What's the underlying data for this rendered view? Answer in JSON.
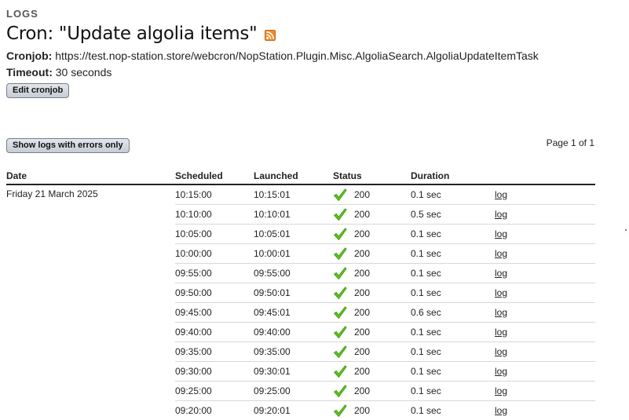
{
  "header": {
    "section_label": "LOGS",
    "title": "Cron: \"Update algolia items\"",
    "rss_icon": "rss-feed-icon"
  },
  "meta": {
    "cronjob_label": "Cronjob:",
    "cronjob_url": "https://test.nop-station.store/webcron/NopStation.Plugin.Misc.AlgoliaSearch.AlgoliaUpdateItemTask",
    "timeout_label": "Timeout:",
    "timeout_value": "30 seconds"
  },
  "actions": {
    "edit_label": "Edit cronjob",
    "errors_filter_label": "Show logs with errors only"
  },
  "pager": {
    "text": "Page 1 of 1"
  },
  "table": {
    "columns": [
      "Date",
      "Scheduled",
      "Launched",
      "Status",
      "Duration",
      ""
    ],
    "date": "Friday 21 March 2025",
    "status_icon": "green-check-icon",
    "rows": [
      {
        "scheduled": "10:15:00",
        "launched": "10:15:01",
        "status": "200",
        "duration": "0.1 sec",
        "log": "log"
      },
      {
        "scheduled": "10:10:00",
        "launched": "10:10:01",
        "status": "200",
        "duration": "0.5 sec",
        "log": "log"
      },
      {
        "scheduled": "10:05:00",
        "launched": "10:05:01",
        "status": "200",
        "duration": "0.1 sec",
        "log": "log"
      },
      {
        "scheduled": "10:00:00",
        "launched": "10:00:01",
        "status": "200",
        "duration": "0.1 sec",
        "log": "log"
      },
      {
        "scheduled": "09:55:00",
        "launched": "09:55:00",
        "status": "200",
        "duration": "0.1 sec",
        "log": "log"
      },
      {
        "scheduled": "09:50:00",
        "launched": "09:50:01",
        "status": "200",
        "duration": "0.1 sec",
        "log": "log"
      },
      {
        "scheduled": "09:45:00",
        "launched": "09:45:01",
        "status": "200",
        "duration": "0.6 sec",
        "log": "log"
      },
      {
        "scheduled": "09:40:00",
        "launched": "09:40:00",
        "status": "200",
        "duration": "0.1 sec",
        "log": "log"
      },
      {
        "scheduled": "09:35:00",
        "launched": "09:35:00",
        "status": "200",
        "duration": "0.1 sec",
        "log": "log"
      },
      {
        "scheduled": "09:30:00",
        "launched": "09:30:01",
        "status": "200",
        "duration": "0.1 sec",
        "log": "log"
      },
      {
        "scheduled": "09:25:00",
        "launched": "09:25:00",
        "status": "200",
        "duration": "0.1 sec",
        "log": "log"
      },
      {
        "scheduled": "09:20:00",
        "launched": "09:20:01",
        "status": "200",
        "duration": "0.1 sec",
        "log": "log"
      }
    ]
  },
  "colors": {
    "rss_orange": "#f08a24",
    "check_green": "#5cc21c",
    "button_border": "#7a7f87"
  }
}
